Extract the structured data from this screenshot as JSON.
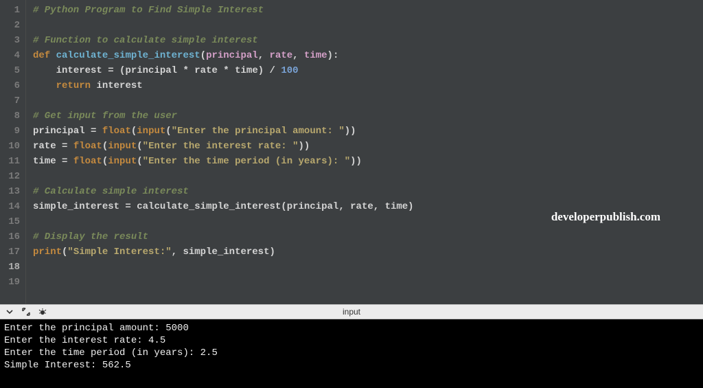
{
  "watermark": "developerpublish.com",
  "gutter": {
    "lines": [
      "1",
      "2",
      "3",
      "4",
      "5",
      "6",
      "7",
      "8",
      "9",
      "10",
      "11",
      "12",
      "13",
      "14",
      "15",
      "16",
      "17",
      "18",
      "19"
    ],
    "caret_line": 18
  },
  "code": {
    "l1_comment": "# Python Program to Find Simple Interest",
    "l3_comment": "# Function to calculate simple interest",
    "l4_def": "def",
    "l4_name": "calculate_simple_interest",
    "l4_p1": "principal",
    "l4_p2": "rate",
    "l4_p3": "time",
    "l5_var": "interest",
    "l5_p1": "principal",
    "l5_p2": "rate",
    "l5_p3": "time",
    "l5_num": "100",
    "l6_ret": "return",
    "l6_var": "interest",
    "l8_comment": "# Get input from the user",
    "l9_var": "principal",
    "l9_float": "float",
    "l9_input": "input",
    "l9_str": "\"Enter the principal amount: \"",
    "l10_var": "rate",
    "l10_float": "float",
    "l10_input": "input",
    "l10_str": "\"Enter the interest rate: \"",
    "l11_var": "time",
    "l11_float": "float",
    "l11_input": "input",
    "l11_str": "\"Enter the time period (in years): \"",
    "l13_comment": "# Calculate simple interest",
    "l14_var": "simple_interest",
    "l14_func": "calculate_simple_interest",
    "l14_a1": "principal",
    "l14_a2": "rate",
    "l14_a3": "time",
    "l16_comment": "# Display the result",
    "l17_print": "print",
    "l17_str": "\"Simple Interest:\"",
    "l17_var": "simple_interest"
  },
  "toolbar": {
    "title": "input"
  },
  "terminal": {
    "l1": "Enter the principal amount: 5000",
    "l2": "Enter the interest rate: 4.5",
    "l3": "Enter the time period (in years): 2.5",
    "l4": "Simple Interest: 562.5"
  }
}
